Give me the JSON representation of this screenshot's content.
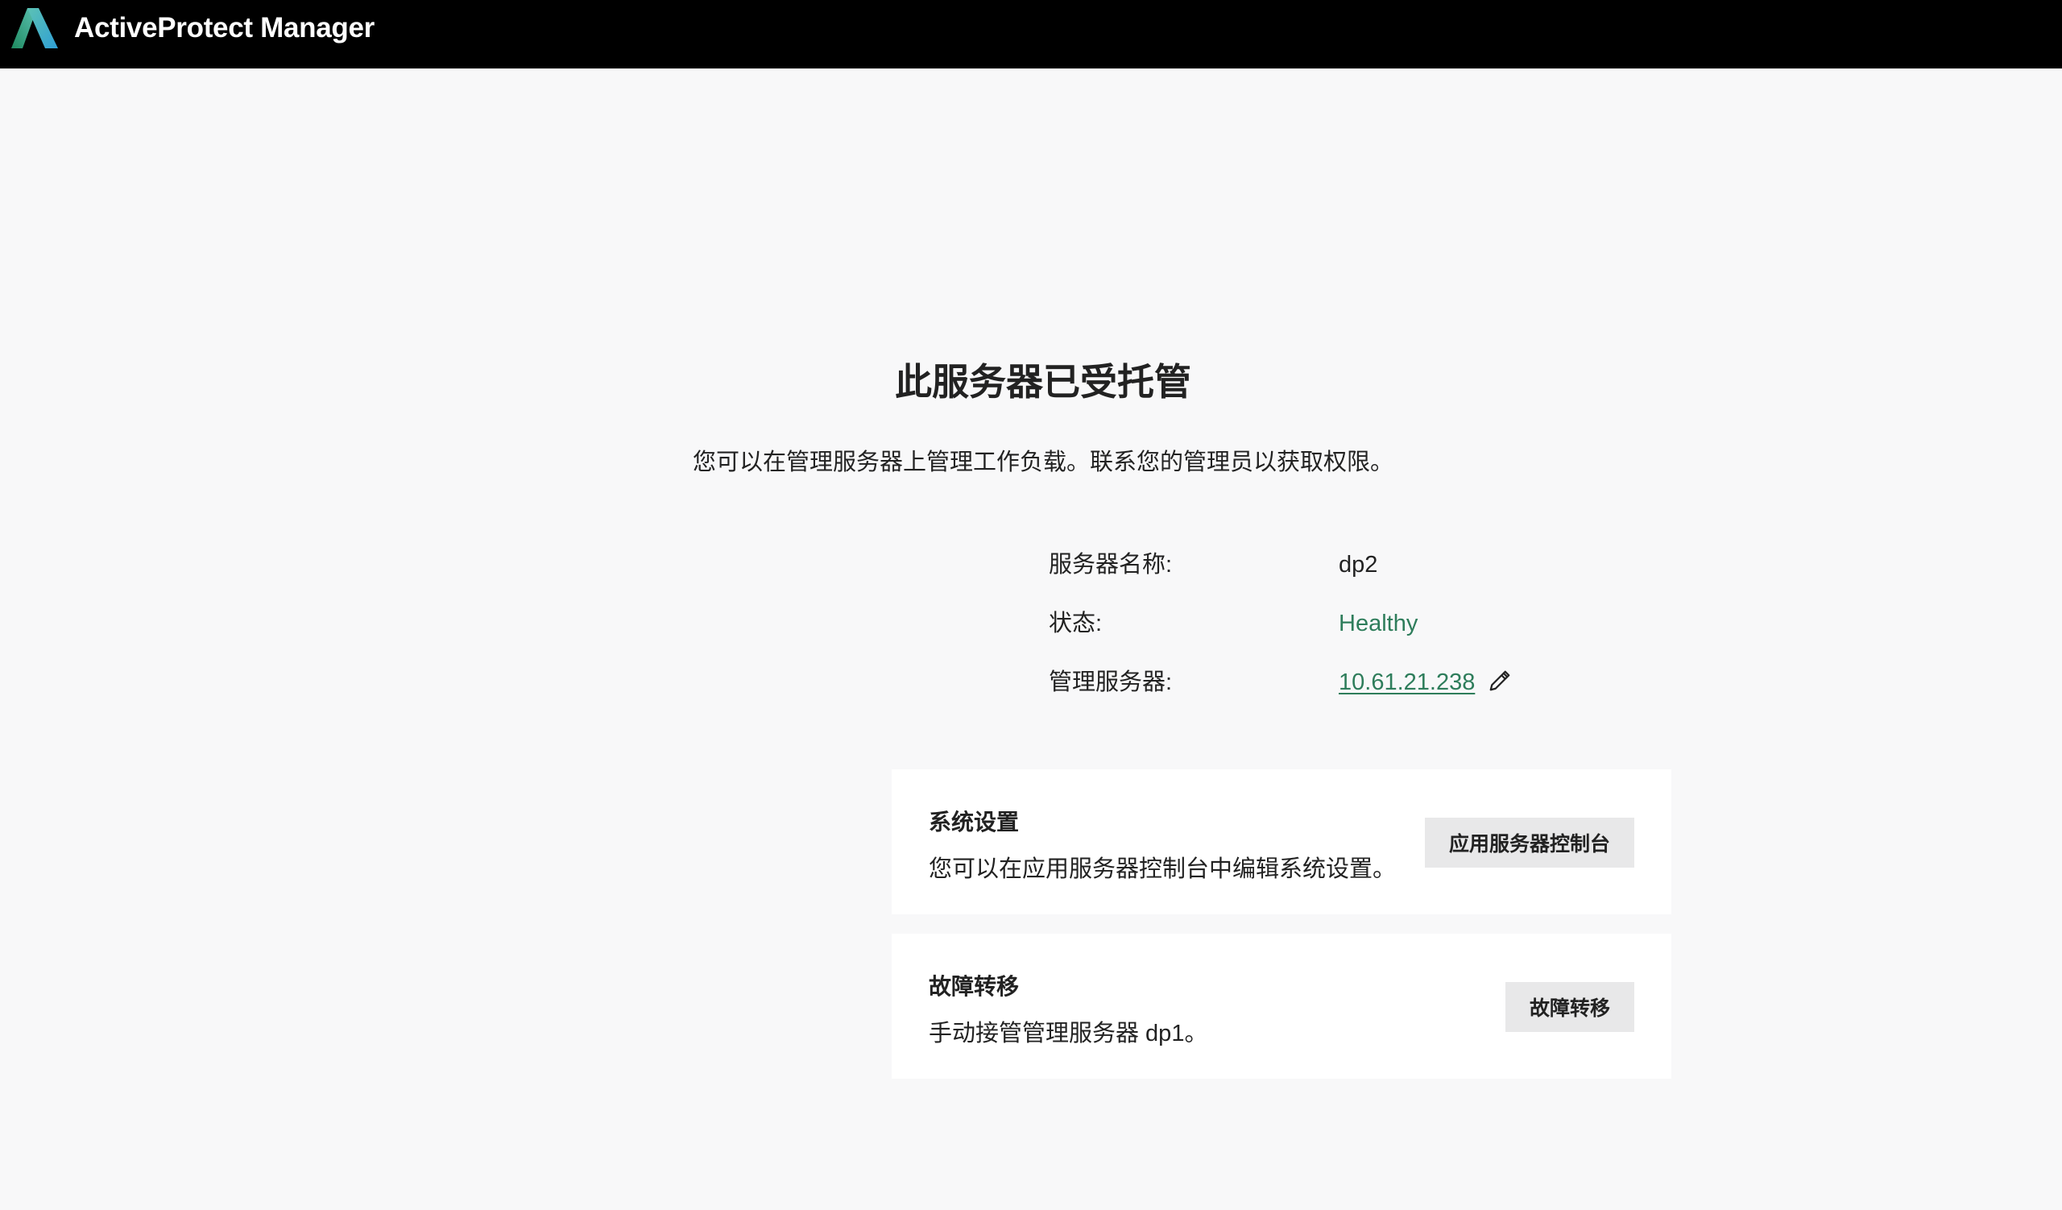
{
  "header": {
    "app_title": "ActiveProtect Manager",
    "logo_icon": "activeprotect-logo-icon",
    "logo_colors": [
      "#1f8a5f",
      "#2f9fd6",
      "#5cc2b4"
    ]
  },
  "main": {
    "title": "此服务器已受托管",
    "subtitle": "您可以在管理服务器上管理工作负载。联系您的管理员以获取权限。",
    "info": {
      "server_name_label": "服务器名称:",
      "server_name_value": "dp2",
      "status_label": "状态:",
      "status_value": "Healthy",
      "status_color": "#2e7d5b",
      "management_server_label": "管理服务器:",
      "management_server_value": "10.61.21.238",
      "edit_icon": "pencil-icon"
    }
  },
  "cards": {
    "system_settings": {
      "title": "系统设置",
      "description": "您可以在应用服务器控制台中编辑系统设置。",
      "button_label": "应用服务器控制台"
    },
    "failover": {
      "title": "故障转移",
      "description": "手动接管管理服务器 dp1。",
      "button_label": "故障转移"
    }
  }
}
